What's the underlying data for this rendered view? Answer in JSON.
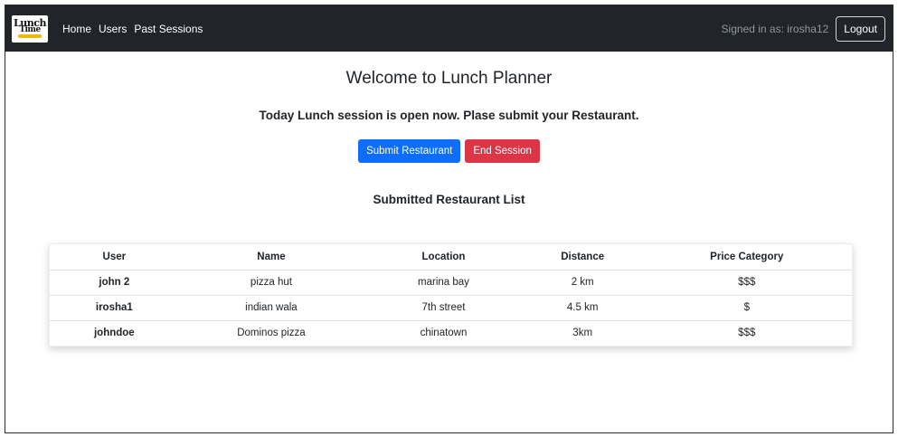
{
  "navbar": {
    "logo": {
      "line1": "Lunch",
      "line2": "Time"
    },
    "links": [
      {
        "label": "Home"
      },
      {
        "label": "Users"
      },
      {
        "label": "Past Sessions"
      }
    ],
    "signed_in_text": "Signed in as: irosha12",
    "logout_label": "Logout",
    "background_color": "#212529"
  },
  "main": {
    "title": "Welcome to Lunch Planner",
    "session_message": "Today Lunch session is open now. Plase submit your Restaurant.",
    "buttons": {
      "submit_label": "Submit Restaurant",
      "submit_color": "#0d6efd",
      "end_label": "End Session",
      "end_color": "#dc3545"
    },
    "list_title": "Submitted Restaurant List"
  },
  "table": {
    "headers": [
      "User",
      "Name",
      "Location",
      "Distance",
      "Price Category"
    ],
    "rows": [
      {
        "user": "john 2",
        "name": "pizza hut",
        "location": "marina bay",
        "distance": "2 km",
        "price": "$$$"
      },
      {
        "user": "irosha1",
        "name": "indian wala",
        "location": "7th street",
        "distance": "4.5 km",
        "price": "$"
      },
      {
        "user": "johndoe",
        "name": "Dominos pizza",
        "location": "chinatown",
        "distance": "3km",
        "price": "$$$"
      }
    ]
  }
}
